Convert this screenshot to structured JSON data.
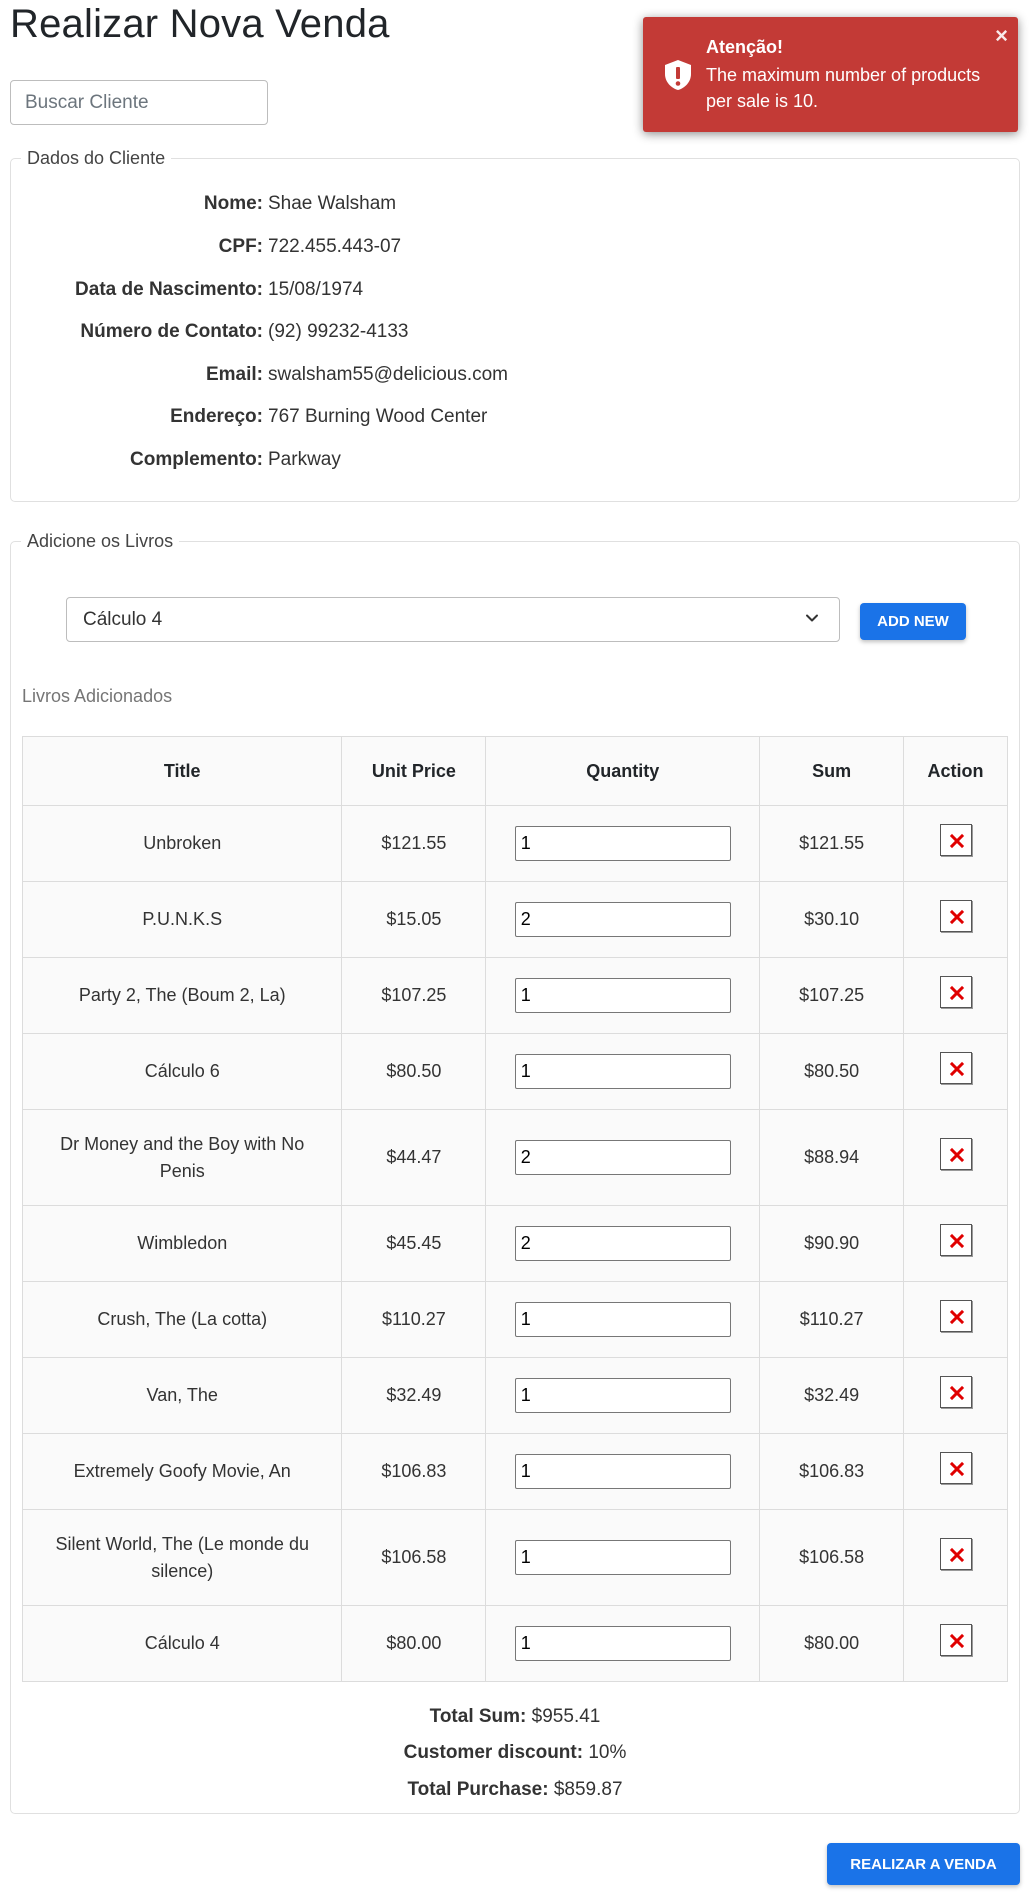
{
  "page": {
    "title": "Realizar Nova Venda"
  },
  "search": {
    "placeholder": "Buscar Cliente"
  },
  "client": {
    "legend": "Dados do Cliente",
    "fields": [
      {
        "label": "Nome:",
        "value": "Shae Walsham"
      },
      {
        "label": "CPF:",
        "value": "722.455.443-07"
      },
      {
        "label": "Data de Nascimento:",
        "value": "15/08/1974"
      },
      {
        "label": "Número de Contato:",
        "value": "(92) 99232-4133"
      },
      {
        "label": "Email:",
        "value": "swalsham55@delicious.com"
      },
      {
        "label": "Endereço:",
        "value": "767 Burning Wood Center"
      },
      {
        "label": "Complemento:",
        "value": "Parkway"
      }
    ]
  },
  "books": {
    "legend": "Adicione os Livros",
    "selected_book": "Cálculo 4",
    "add_button": "ADD NEW",
    "added_caption": "Livros Adicionados",
    "columns": [
      "Title",
      "Unit Price",
      "Quantity",
      "Sum",
      "Action"
    ],
    "rows": [
      {
        "title": "Unbroken",
        "unit_price": "$121.55",
        "quantity": "1",
        "sum": "$121.55"
      },
      {
        "title": "P.U.N.K.S",
        "unit_price": "$15.05",
        "quantity": "2",
        "sum": "$30.10"
      },
      {
        "title": "Party 2, The (Boum 2, La)",
        "unit_price": "$107.25",
        "quantity": "1",
        "sum": "$107.25"
      },
      {
        "title": "Cálculo 6",
        "unit_price": "$80.50",
        "quantity": "1",
        "sum": "$80.50"
      },
      {
        "title": "Dr Money and the Boy with No Penis",
        "unit_price": "$44.47",
        "quantity": "2",
        "sum": "$88.94"
      },
      {
        "title": "Wimbledon",
        "unit_price": "$45.45",
        "quantity": "2",
        "sum": "$90.90"
      },
      {
        "title": "Crush, The (La cotta)",
        "unit_price": "$110.27",
        "quantity": "1",
        "sum": "$110.27"
      },
      {
        "title": "Van, The",
        "unit_price": "$32.49",
        "quantity": "1",
        "sum": "$32.49"
      },
      {
        "title": "Extremely Goofy Movie, An",
        "unit_price": "$106.83",
        "quantity": "1",
        "sum": "$106.83"
      },
      {
        "title": "Silent World, The (Le monde du silence)",
        "unit_price": "$106.58",
        "quantity": "1",
        "sum": "$106.58"
      },
      {
        "title": "Cálculo 4",
        "unit_price": "$80.00",
        "quantity": "1",
        "sum": "$80.00"
      }
    ],
    "totals": {
      "total_sum_label": "Total Sum:",
      "total_sum_value": "$955.41",
      "discount_label": "Customer discount:",
      "discount_value": "10%",
      "total_purchase_label": "Total Purchase:",
      "total_purchase_value": "$859.87"
    }
  },
  "finish_button": "REALIZAR A VENDA",
  "toast": {
    "title": "Atenção!",
    "message": "The maximum number of products per sale is 10.",
    "close": "×"
  },
  "icons": {
    "toast": "shield-alert-icon",
    "select": "chevron-down-icon",
    "delete": "close-icon",
    "toast_close": "close-icon"
  },
  "colors": {
    "primary": "#1a73e8",
    "toast_bg": "#c33a36",
    "delete_x": "#e00000"
  }
}
